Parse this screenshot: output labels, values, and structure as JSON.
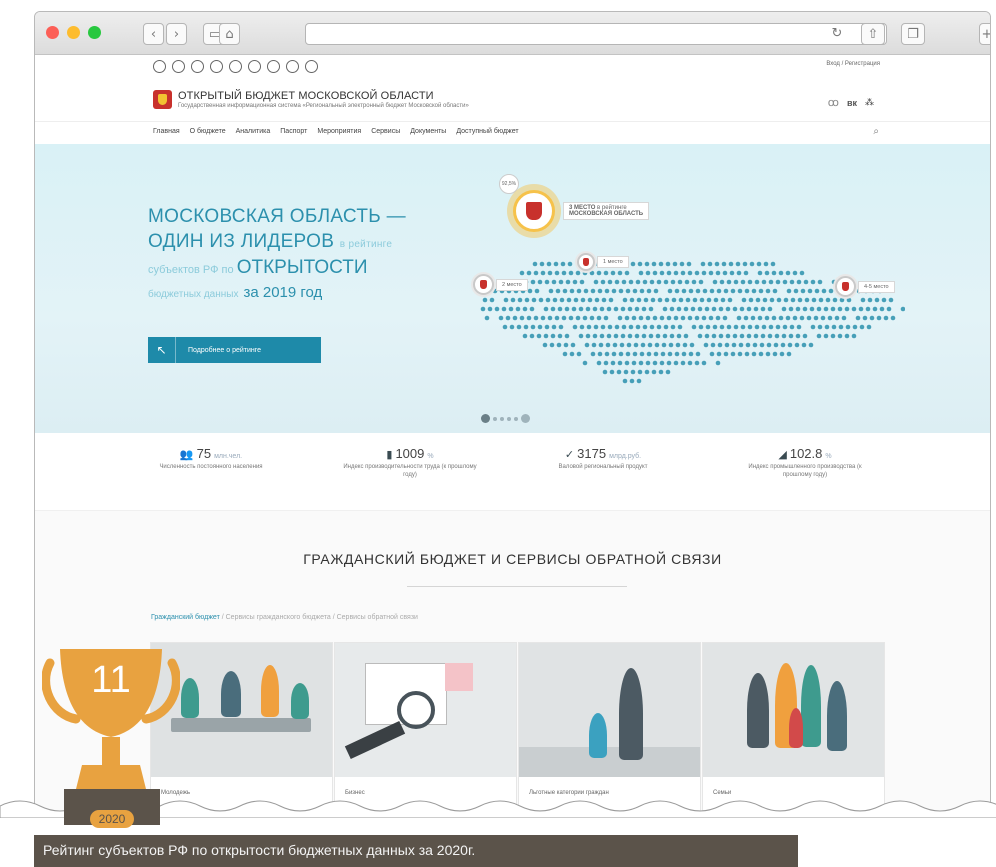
{
  "browser": {
    "url": ""
  },
  "header": {
    "login": "Вход / Регистрация",
    "title": "ОТКРЫТЫЙ БЮДЖЕТ МОСКОВСКОЙ ОБЛАСТИ",
    "subtitle": "Государственная информационная система «Региональный электронный бюджет Московской области»",
    "social": "вк"
  },
  "nav": {
    "items": [
      "Главная",
      "О бюджете",
      "Аналитика",
      "Паспорт",
      "Мероприятия",
      "Сервисы",
      "Документы",
      "Доступный бюджет"
    ]
  },
  "hero": {
    "line1": "МОСКОВСКАЯ ОБЛАСТЬ —",
    "line2_big": "ОДИН ИЗ ЛИДЕРОВ",
    "line2_small": "в рейтинге",
    "line3_small": "субъектов РФ по",
    "line3_big": "ОТКРЫТОСТИ",
    "line4_small": "бюджетных данных",
    "line4_year": "за 2019 год",
    "button": "Подробнее о рейтинге",
    "pins": {
      "first_pct": "92,5%",
      "first_label_bold": "3 МЕСТО",
      "first_label": "в рейтинге",
      "first_region": "МОСКОВСКАЯ ОБЛАСТЬ",
      "place1": "1 место",
      "place2": "2 место",
      "place45": "4-5 место"
    }
  },
  "stats": [
    {
      "value": "75",
      "unit": "млн.чел.",
      "label": "Численность постоянного населения"
    },
    {
      "value": "1009",
      "unit": "%",
      "label": "Индекс производительности труда (к прошлому году)"
    },
    {
      "value": "3175",
      "unit": "млрд.руб.",
      "label": "Валовой региональный продукт"
    },
    {
      "value": "102.8",
      "unit": "%",
      "label": "Индекс промышленного производства (к прошлому году)"
    }
  ],
  "section": {
    "title": "ГРАЖДАНСКИЙ БЮДЖЕТ И СЕРВИСЫ ОБРАТНОЙ СВЯЗИ",
    "breadcrumb": [
      "Гражданский бюджет",
      "Сервисы гражданского бюджета",
      "Сервисы обратной связи"
    ],
    "cards": [
      "Молодежь",
      "Бизнес",
      "Льготные категории граждан",
      "Семьи"
    ]
  },
  "trophy": {
    "number": "11",
    "year": "2020"
  },
  "caption": "Рейтинг субъектов РФ по открытости бюджетных данных за 2020г.",
  "colors": {
    "accent": "#2c90ad",
    "button": "#1e8aa9",
    "trophy": "#e8a240",
    "caption_bg": "#5b534a"
  }
}
